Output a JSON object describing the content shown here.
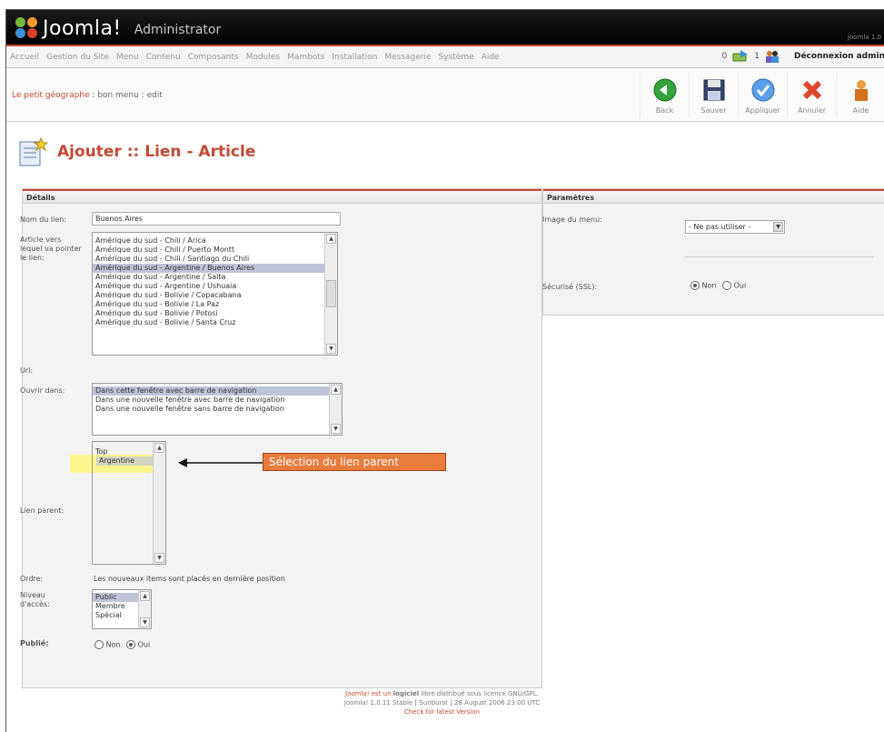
{
  "header": {
    "logo_text": "Joomla!",
    "subtitle": "Administrator",
    "version_tag": "Joomla 1.0"
  },
  "menu": {
    "items": [
      "Accueil",
      "Gestion du Site",
      "Menu",
      "Contenu",
      "Composants",
      "Modules",
      "Mambots",
      "Installation",
      "Messagerie",
      "Système",
      "Aide"
    ]
  },
  "status": {
    "messages_count": "0",
    "users_count": "1",
    "logout_label": "Déconnexion admin"
  },
  "toolbar": {
    "breadcrumb_menu": "Le petit géographe",
    "breadcrumb_rest": " : bon menu : edit",
    "buttons": [
      {
        "label": "Back",
        "icon": "back-arrow-icon"
      },
      {
        "label": "Sauver",
        "icon": "save-disk-icon"
      },
      {
        "label": "Appliquer",
        "icon": "apply-check-icon"
      },
      {
        "label": "Annuler",
        "icon": "cancel-x-icon"
      },
      {
        "label": "Aide",
        "icon": "help-person-icon"
      }
    ]
  },
  "page": {
    "title": "Ajouter :: Lien - Article"
  },
  "details": {
    "heading": "Détails",
    "name_label": "Nom du lien:",
    "name_value": "Buenos Aires",
    "article_label": "Article vers lequel va pointer le lien:",
    "articles": [
      "Amérique du sud - Chili / Arica",
      "Amérique du sud - Chili / Puerto Montt",
      "Amérique du sud - Chili / Santiago du Chili",
      "Amérique du sud - Argentine / Buenos Aires",
      "Amérique du sud - Argentine / Salta",
      "Amérique du sud - Argentine / Ushuaia",
      "Amérique du sud - Bolivie / Copacabana",
      "Amérique du sud - Bolivie / La Paz",
      "Amérique du sud - Bolivie / Potosi",
      "Amérique du sud - Bolivie / Santa Cruz"
    ],
    "article_selected_index": 3,
    "url_label": "Url:",
    "open_label": "Ouvrir dans:",
    "open_options": [
      "Dans cette fenêtre avec barre de navigation",
      "Dans une nouvelle fenêtre avec barre de navigation",
      "Dans une nouvelle fenêtre sans barre de navigation"
    ],
    "parent_label": "Lien parent:",
    "parent_options": [
      "Top",
      "Argentine"
    ],
    "order_label": "Ordre:",
    "order_text": "Les nouveaux items sont placés en dernière position",
    "access_label": "Niveau d'accès:",
    "access_options": [
      "Public",
      "Membre",
      "Spécial"
    ],
    "published_label": "Publié:",
    "no_label": "Non",
    "yes_label": "Oui"
  },
  "params": {
    "heading": "Paramètres",
    "menu_image_label": "Image du menu:",
    "menu_image_value": "- Ne pas utiliser -",
    "separator_text": "",
    "secure_label": "Sécurisé (SSL):",
    "no_label": "Non",
    "yes_label": "Oui"
  },
  "annotation": {
    "text": "Sélection du lien parent"
  },
  "footer": {
    "line1_a": "Joomla! est un ",
    "line1_b": "logiciel",
    "line1_c": " libre distribué sous licence GNU/GPL.",
    "line2": "Joomla! 1.0.11 Stable [ Sunburst ] 28 August 2006 23:00 UTC",
    "line3": "Check for latest Version"
  },
  "colors": {
    "brand": "#c64934",
    "annotation": "#e97b3c",
    "highlight": "#fff76e"
  }
}
